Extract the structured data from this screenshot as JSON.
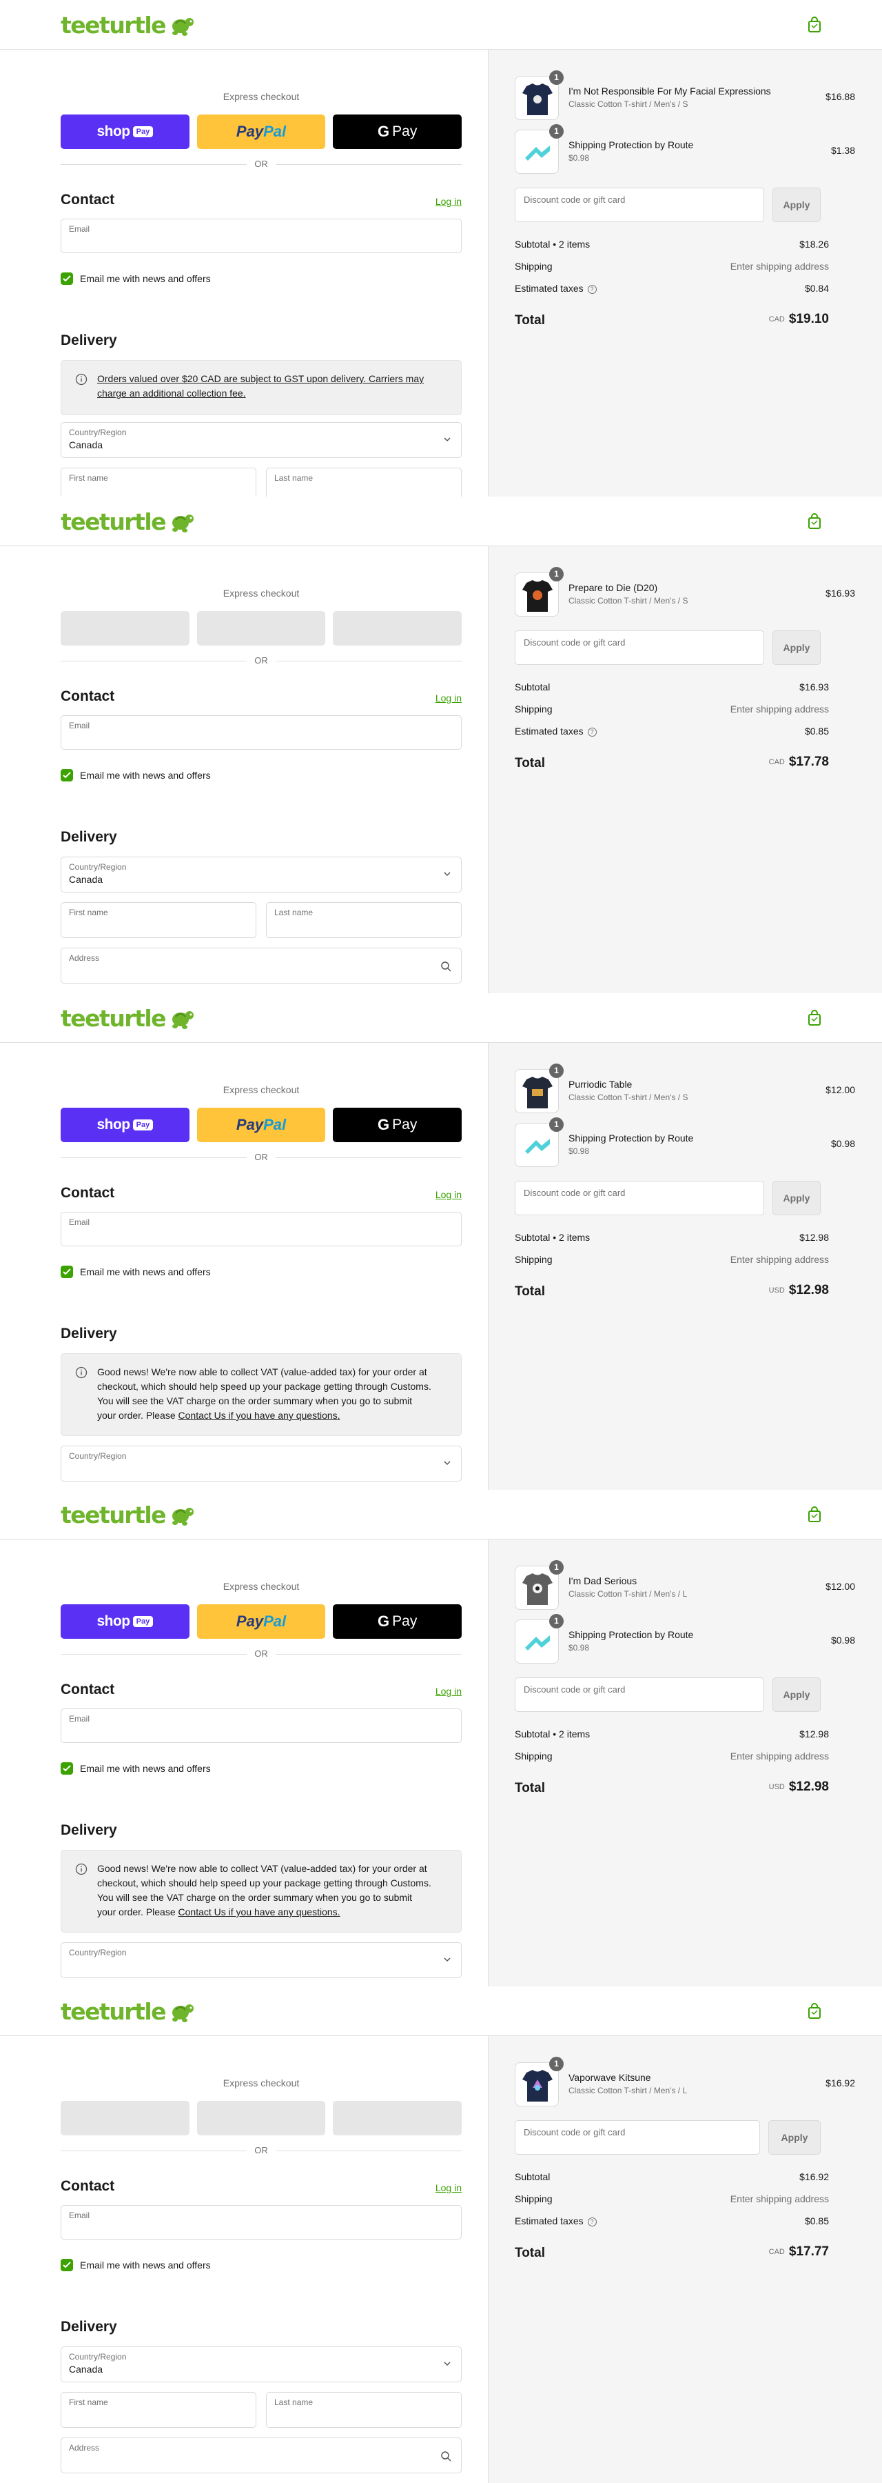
{
  "brand": {
    "logo_text": "teeturtle",
    "accent": "#6fb52c",
    "link_color": "#3ba200"
  },
  "checkout": {
    "express_label": "Express checkout",
    "or_label": "OR",
    "shop_pay": {
      "word": "shop",
      "pill": "Pay"
    },
    "paypal": {
      "part1": "Pay",
      "part2": "Pal"
    },
    "gpay": {
      "g": "G",
      "text": "Pay"
    },
    "contact_heading": "Contact",
    "login_link": "Log in",
    "email_label": "Email",
    "news_label": "Email me with news and offers",
    "delivery_heading": "Delivery",
    "country_label": "Country/Region",
    "first_name_label": "First name",
    "last_name_label": "Last name",
    "address_label": "Address",
    "discount_placeholder": "Discount code or gift card",
    "apply_label": "Apply",
    "shipping_label": "Shipping",
    "shipping_value": "Enter shipping address",
    "taxes_label": "Estimated taxes",
    "total_label": "Total"
  },
  "notices": {
    "gst": "Orders valued over $20 CAD are subject to GST upon delivery. Carriers may charge an additional collection fee.",
    "vat_before": "Good news! We're now able to collect VAT (value-added tax) for your order at checkout, which should help speed up your package getting through Customs. You will see the VAT charge on the order summary when you go to submit your order. Please ",
    "vat_link": "Contact Us",
    "vat_after": " if you have any questions."
  },
  "screens": [
    {
      "country_value": "Canada",
      "items": [
        {
          "name": "I'm Not Responsible For My Facial Expressions",
          "variant": "Classic Cotton T-shirt / Men's / S",
          "price": "$16.88",
          "qty": "1"
        },
        {
          "name": "Shipping Protection by Route",
          "variant": "$0.98",
          "price": "$1.38",
          "qty": "1"
        }
      ],
      "subtotal_label": "Subtotal • 2 items",
      "subtotal": "$18.26",
      "taxes": "$0.84",
      "currency": "CAD",
      "total": "$19.10"
    },
    {
      "country_value": "Canada",
      "items": [
        {
          "name": "Prepare to Die (D20)",
          "variant": "Classic Cotton T-shirt / Men's / S",
          "price": "$16.93",
          "qty": "1"
        }
      ],
      "subtotal_label": "Subtotal",
      "subtotal": "$16.93",
      "taxes": "$0.85",
      "currency": "CAD",
      "total": "$17.78"
    },
    {
      "country_value": "",
      "items": [
        {
          "name": "Purriodic Table",
          "variant": "Classic Cotton T-shirt / Men's / S",
          "price": "$12.00",
          "qty": "1"
        },
        {
          "name": "Shipping Protection by Route",
          "variant": "$0.98",
          "price": "$0.98",
          "qty": "1"
        }
      ],
      "subtotal_label": "Subtotal • 2 items",
      "subtotal": "$12.98",
      "currency": "USD",
      "total": "$12.98"
    },
    {
      "country_value": "",
      "items": [
        {
          "name": "I'm Dad Serious",
          "variant": "Classic Cotton T-shirt / Men's / L",
          "price": "$12.00",
          "qty": "1"
        },
        {
          "name": "Shipping Protection by Route",
          "variant": "$0.98",
          "price": "$0.98",
          "qty": "1"
        }
      ],
      "subtotal_label": "Subtotal • 2 items",
      "subtotal": "$12.98",
      "currency": "USD",
      "total": "$12.98"
    },
    {
      "country_value": "Canada",
      "items": [
        {
          "name": "Vaporwave Kitsune",
          "variant": "Classic Cotton T-shirt / Men's / L",
          "price": "$16.92",
          "qty": "1"
        }
      ],
      "subtotal_label": "Subtotal",
      "subtotal": "$16.92",
      "taxes": "$0.85",
      "currency": "CAD",
      "total": "$17.77"
    }
  ]
}
